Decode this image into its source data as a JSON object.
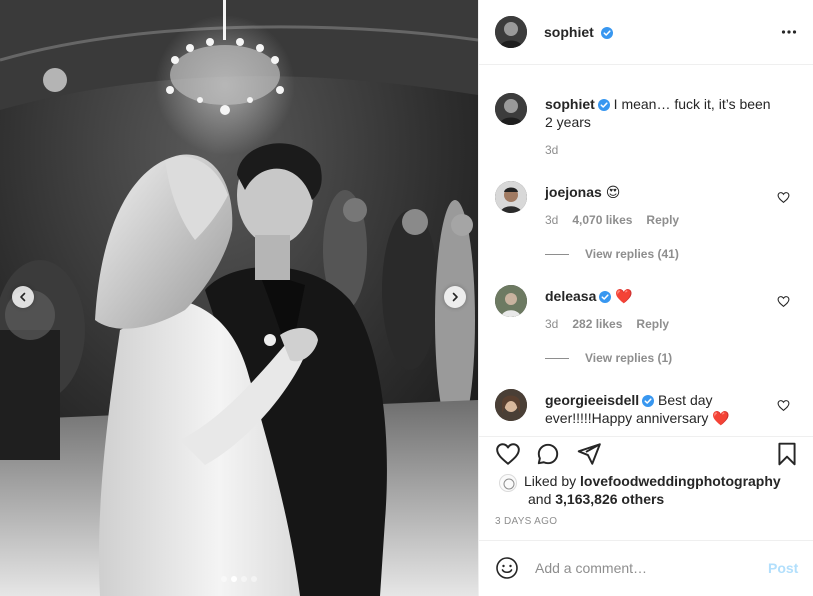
{
  "post_author": {
    "username": "sophiet",
    "verified": true
  },
  "caption": {
    "username": "sophiet",
    "text": "I mean… fuck it, it’s been 2 years",
    "age": "3d"
  },
  "comments": [
    {
      "username": "joejonas",
      "verified": false,
      "text": "😍",
      "age": "3d",
      "likes": "4,070 likes",
      "reply_label": "Reply",
      "view_replies": "View replies (41)"
    },
    {
      "username": "deleasa",
      "verified": true,
      "text": "❤️",
      "age": "3d",
      "likes": "282 likes",
      "reply_label": "Reply",
      "view_replies": "View replies (1)"
    },
    {
      "username": "georgieeisdell",
      "verified": true,
      "text": "Best day ever!!!!!Happy anniversary ❤️"
    }
  ],
  "likes": {
    "prefix": "Liked by",
    "first_liker": "lovefoodweddingphotography",
    "and": "and",
    "others": "3,163,826 others"
  },
  "time_ago": "3 DAYS AGO",
  "add_comment": {
    "placeholder": "Add a comment…",
    "post_label": "Post"
  },
  "carousel": {
    "slide_count": 4,
    "active_slide": 2
  },
  "colors": {
    "verified_blue": "#3897f0",
    "post_disabled": "#b2dffc",
    "heart_red": "#ed4956",
    "muted_text": "#8e8e8e"
  },
  "icons": [
    "more-icon",
    "heart-icon",
    "comment-icon",
    "share-icon",
    "bookmark-icon",
    "emoji-icon",
    "verified-icon",
    "chevron-left-icon",
    "chevron-right-icon"
  ]
}
